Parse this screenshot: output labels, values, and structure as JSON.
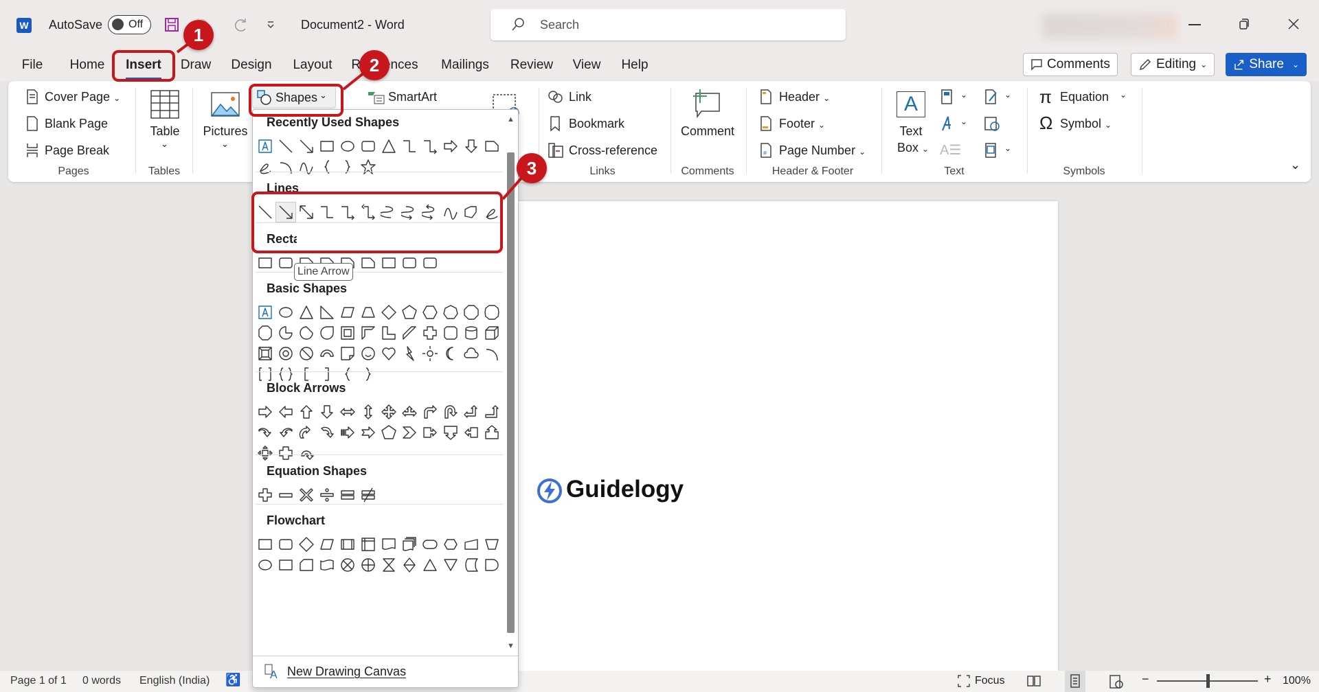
{
  "titlebar": {
    "autosave_label": "AutoSave",
    "toggle_state": "Off",
    "title": "Document2  -  Word",
    "search_placeholder": "Search"
  },
  "menu": {
    "tabs": [
      "File",
      "Home",
      "Insert",
      "Draw",
      "Design",
      "Layout",
      "References",
      "Mailings",
      "Review",
      "View",
      "Help"
    ],
    "active": "Insert",
    "comments": "Comments",
    "editing": "Editing",
    "share": "Share"
  },
  "ribbon": {
    "pages": {
      "cover": "Cover Page",
      "blank": "Blank Page",
      "break": "Page Break",
      "label": "Pages"
    },
    "tables": {
      "table": "Table",
      "label": "Tables"
    },
    "illustrations": {
      "pictures": "Pictures",
      "shapes": "Shapes",
      "smartart": "SmartArt"
    },
    "links": {
      "link": "Link",
      "bookmark": "Bookmark",
      "crossref": "Cross-reference",
      "label": "Links"
    },
    "comments": {
      "comment": "Comment",
      "label": "Comments"
    },
    "headerfooter": {
      "header": "Header",
      "footer": "Footer",
      "pagenumber": "Page Number",
      "label": "Header & Footer"
    },
    "text": {
      "textbox1": "Text",
      "textbox2": "Box",
      "label": "Text"
    },
    "symbols": {
      "equation": "Equation",
      "symbol": "Symbol",
      "label": "Symbols"
    }
  },
  "shapes_menu": {
    "sections": [
      {
        "title": "Recently Used Shapes",
        "rows": [
          [
            "textbox",
            "line",
            "arrow",
            "rect",
            "oval",
            "roundrect",
            "triangle",
            "elbow",
            "elbowarrow",
            "rightarrow",
            "downarrow",
            "snip"
          ],
          [
            "scribble",
            "arc",
            "curve",
            "lbrace",
            "rbrace",
            "star"
          ]
        ]
      },
      {
        "title": "Lines",
        "rows": [
          [
            "line",
            "arrow",
            "dblarrow",
            "elbow",
            "elbowarrow",
            "elbowdbl",
            "curved",
            "curvedarrow",
            "curveddbl",
            "curve",
            "freeform",
            "scribble"
          ]
        ]
      },
      {
        "title": "Rectangles",
        "rows": [
          [
            "rect",
            "roundrect",
            "snip",
            "snip",
            "snip",
            "snip",
            "rect",
            "roundrect",
            "roundrect"
          ]
        ]
      },
      {
        "title": "Basic Shapes",
        "rows": [
          [
            "textbox",
            "oval",
            "triangle",
            "righttri",
            "parallelogram",
            "trapezoid",
            "diamond",
            "pentagon",
            "hexagon",
            "heptagon",
            "octagon",
            "decagon"
          ],
          [
            "dodecagon",
            "pie",
            "chord",
            "teardrop",
            "frame",
            "halfframe",
            "lshape",
            "diagstripe",
            "cross",
            "plaque",
            "can",
            "cube"
          ],
          [
            "bevel",
            "donut",
            "nosymbol",
            "blockarc",
            "foldedcorner",
            "smiley",
            "heart",
            "lightning",
            "sun",
            "moon",
            "cloud",
            "arc"
          ],
          [
            "dblbracket",
            "dblbrace",
            "lbracket",
            "rbracket",
            "lbrace",
            "rbrace"
          ]
        ]
      },
      {
        "title": "Block Arrows",
        "rows": [
          [
            "rightarrow",
            "leftarrow",
            "uparrow",
            "downarrow",
            "lrarrow",
            "udarrow",
            "quadarrow",
            "lrup",
            "bentarrow",
            "uturn",
            "leftup",
            "bentup"
          ],
          [
            "curvedright",
            "curvedleft",
            "curvedup",
            "curveddown",
            "stripedright",
            "notched",
            "pentagon",
            "chevron",
            "rightcallout",
            "downcallout",
            "leftcallout",
            "upcallout"
          ],
          [
            "quadcallout",
            "cross",
            "circular"
          ]
        ]
      },
      {
        "title": "Equation Shapes",
        "rows": [
          [
            "plus",
            "minus",
            "multiply",
            "divide",
            "equal",
            "notequal"
          ]
        ]
      },
      {
        "title": "Flowchart",
        "rows": [
          [
            "rect",
            "roundrect",
            "diamond",
            "parallelogram",
            "predefined",
            "internal",
            "document",
            "multidoc",
            "terminator",
            "preparation",
            "manualinput",
            "manualop"
          ],
          [
            "oval",
            "rect",
            "card",
            "punched",
            "summing",
            "or",
            "collate",
            "sort",
            "extract",
            "merge",
            "stored",
            "delay"
          ]
        ]
      }
    ],
    "new_canvas": "New Drawing Canvas",
    "tooltip": "Line Arrow",
    "hovered": "arrow"
  },
  "document": {
    "logo_text": "Guidelogy"
  },
  "annotations": [
    "1",
    "2",
    "3"
  ],
  "status": {
    "page": "Page 1 of 1",
    "words": "0 words",
    "language": "English (India)",
    "focus": "Focus",
    "zoom": "100%",
    "zoom_level_percent": 100
  },
  "colors": {
    "accent": "#185abd",
    "annotation": "#c8161d",
    "share_bg": "#1a5fc8"
  }
}
